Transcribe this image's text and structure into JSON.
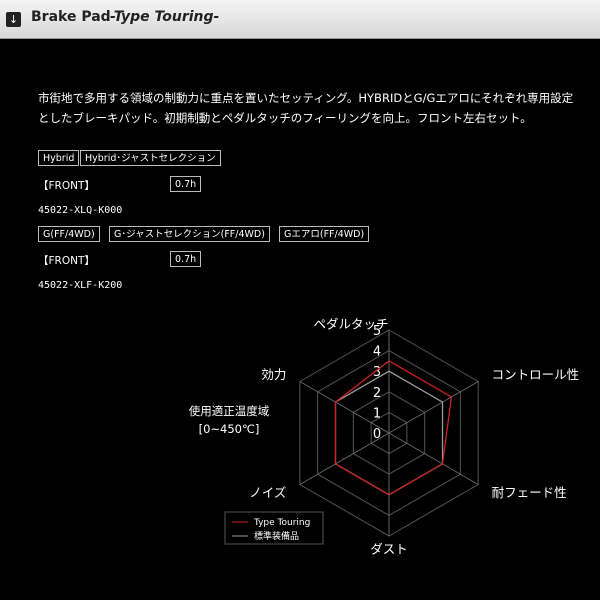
{
  "header": {
    "icon": "arrow-down-icon",
    "title": "Brake Pad",
    "subtitle": "-Type Touring-"
  },
  "description": [
    "市街地で多用する領域の制動力に重点を置いたセッティング。HYBRIDとG/Gエアロにそれぞれ専用設定",
    "としたブレーキパッド。初期制動とペダルタッチのフィーリングを向上。フロント左右セット。"
  ],
  "group1": {
    "tags": [
      "Hybrid",
      "Hybrid･ジャストセレクション"
    ],
    "position_label": "【FRONT】",
    "thickness": "0.7h",
    "part_number": "45022-XLQ-K000"
  },
  "group2": {
    "tags": [
      "G(FF/4WD)",
      "G･ジャストセレクション(FF/4WD)",
      "Gエアロ(FF/4WD)"
    ],
    "position_label": "【FRONT】",
    "thickness": "0.7h",
    "part_number": "45022-XLF-K200"
  },
  "chart_data": {
    "type": "radar",
    "axes": [
      "ペダルタッチ",
      "コントロール性",
      "耐フェード性",
      "ダスト",
      "ノイズ",
      "効力"
    ],
    "scale_ticks": [
      "0",
      "1",
      "2",
      "3",
      "4",
      "5"
    ],
    "range": [
      0,
      5
    ],
    "center_label": [
      "使用適正温度域",
      "[0~450℃]"
    ],
    "series": [
      {
        "name": "Type Touring",
        "color": "#cc2222",
        "values": [
          3.5,
          3.5,
          3.0,
          3.0,
          3.0,
          3.0
        ]
      },
      {
        "name": "標準装備品",
        "color": "#9a9a9a",
        "values": [
          3.0,
          3.0,
          3.0,
          3.0,
          3.0,
          3.0
        ]
      }
    ],
    "legend_position": "bottom-left"
  }
}
